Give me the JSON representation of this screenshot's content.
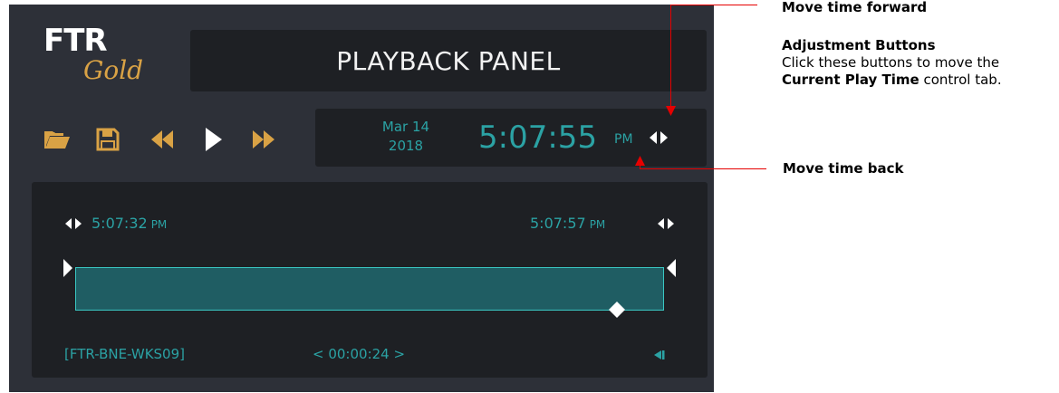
{
  "header": {
    "title": "PLAYBACK PANEL",
    "logo_main": "FTR",
    "logo_sub": "Gold"
  },
  "toolbar": {
    "buttons": [
      {
        "icon": "folder-open-icon"
      },
      {
        "icon": "save-icon"
      },
      {
        "icon": "rewind-icon"
      },
      {
        "icon": "play-icon"
      },
      {
        "icon": "fast-forward-icon"
      }
    ]
  },
  "current": {
    "date_line1": "Mar 14",
    "date_line2": "2018",
    "time": "5:07:55",
    "ampm": "PM"
  },
  "timeline": {
    "start_time": "5:07:32",
    "start_ampm": "PM",
    "end_time": "5:07:57",
    "end_ampm": "PM",
    "playhead_fraction": 0.92,
    "channel": "[FTR-BNE-WKS09]",
    "duration": "< 00:00:24 >"
  },
  "annotations": {
    "forward_label": "Move time forward",
    "adjust_title": "Adjustment Buttons",
    "adjust_line1": "Click these buttons to move the",
    "adjust_bold": "Current Play Time",
    "adjust_rest": " control tab.",
    "back_label": "Move time back"
  },
  "colors": {
    "panel": "#2d3038",
    "box": "#1e2024",
    "accent_teal": "#2ba2a4",
    "accent_gold": "#d9a245",
    "track_fill": "#1f5d63",
    "annotation_red": "#e60000"
  }
}
